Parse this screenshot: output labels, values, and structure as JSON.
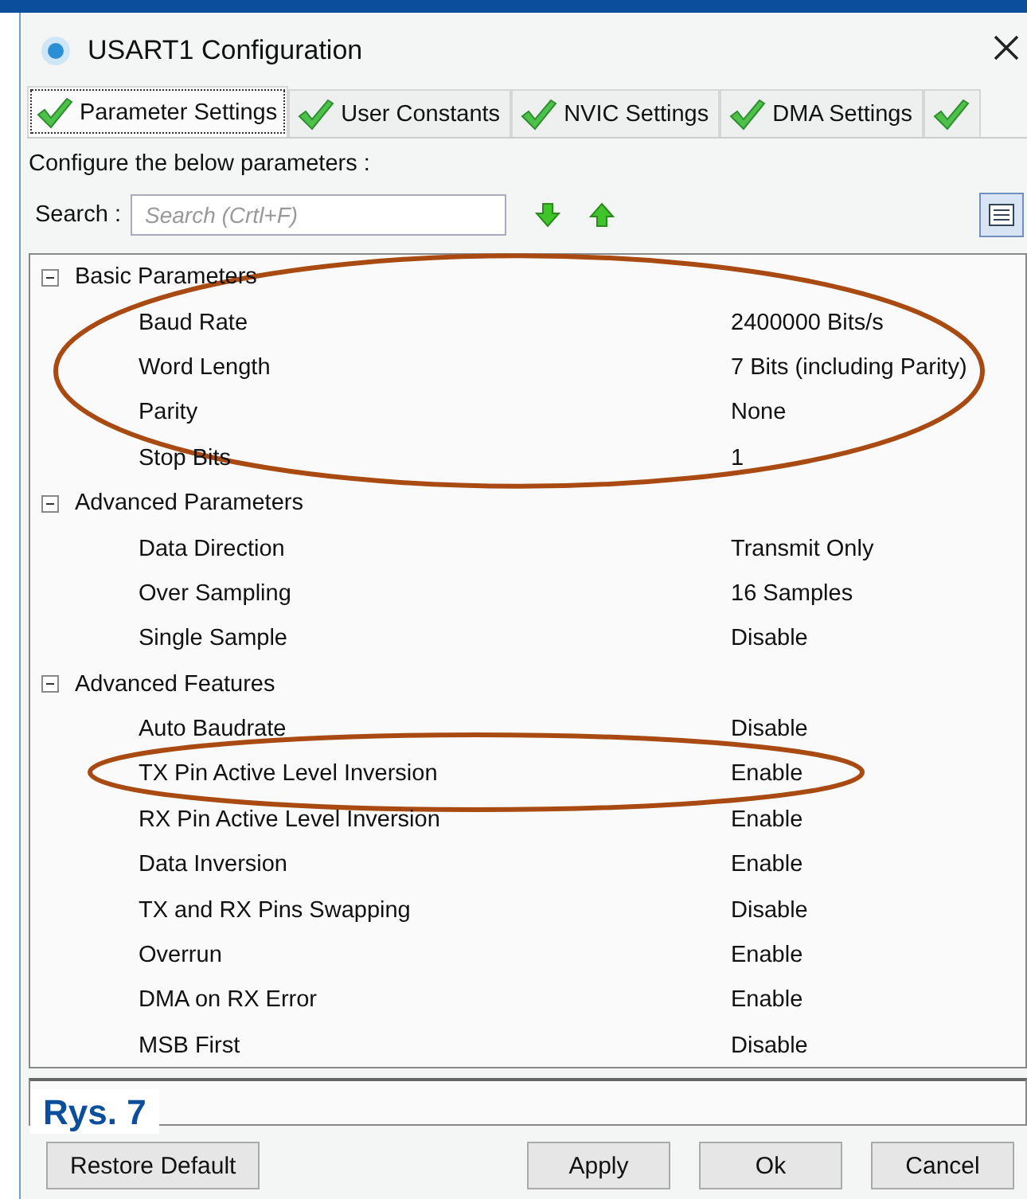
{
  "window": {
    "title": "USART1 Configuration"
  },
  "tabs": [
    {
      "label": "Parameter Settings",
      "selected": true
    },
    {
      "label": "User Constants",
      "selected": false
    },
    {
      "label": "NVIC Settings",
      "selected": false
    },
    {
      "label": "DMA Settings",
      "selected": false
    },
    {
      "selected": false
    }
  ],
  "instructions": "Configure the below parameters :",
  "search": {
    "label": "Search :",
    "placeholder": "Search (Crtl+F)"
  },
  "tree": {
    "groups": [
      {
        "name": "Basic Parameters",
        "expanded": true,
        "circled": true,
        "rows": [
          {
            "name": "Baud Rate",
            "value": "2400000 Bits/s",
            "circled": false
          },
          {
            "name": "Word Length",
            "value": "7 Bits (including Parity)",
            "circled": false
          },
          {
            "name": "Parity",
            "value": "None",
            "circled": false
          },
          {
            "name": "Stop Bits",
            "value": "1",
            "circled": false
          }
        ]
      },
      {
        "name": "Advanced Parameters",
        "expanded": true,
        "circled": false,
        "rows": [
          {
            "name": "Data Direction",
            "value": "Transmit Only",
            "circled": false
          },
          {
            "name": "Over Sampling",
            "value": "16 Samples",
            "circled": false
          },
          {
            "name": "Single Sample",
            "value": "Disable",
            "circled": false
          }
        ]
      },
      {
        "name": "Advanced Features",
        "expanded": true,
        "circled": false,
        "rows": [
          {
            "name": "Auto Baudrate",
            "value": "Disable",
            "circled": false
          },
          {
            "name": "TX Pin Active Level Inversion",
            "value": "Enable",
            "circled": true
          },
          {
            "name": "RX Pin Active Level Inversion",
            "value": "Enable",
            "circled": false
          },
          {
            "name": "Data Inversion",
            "value": "Enable",
            "circled": false
          },
          {
            "name": "TX and RX Pins Swapping",
            "value": "Disable",
            "circled": false
          },
          {
            "name": "Overrun",
            "value": "Enable",
            "circled": false
          },
          {
            "name": "DMA on RX Error",
            "value": "Enable",
            "circled": false
          },
          {
            "name": "MSB First",
            "value": "Disable",
            "circled": false
          }
        ]
      }
    ]
  },
  "figure_label": "Rys. 7",
  "buttons": {
    "left": [
      "Restore Default"
    ],
    "right": [
      "Apply",
      "Ok",
      "Cancel"
    ]
  }
}
